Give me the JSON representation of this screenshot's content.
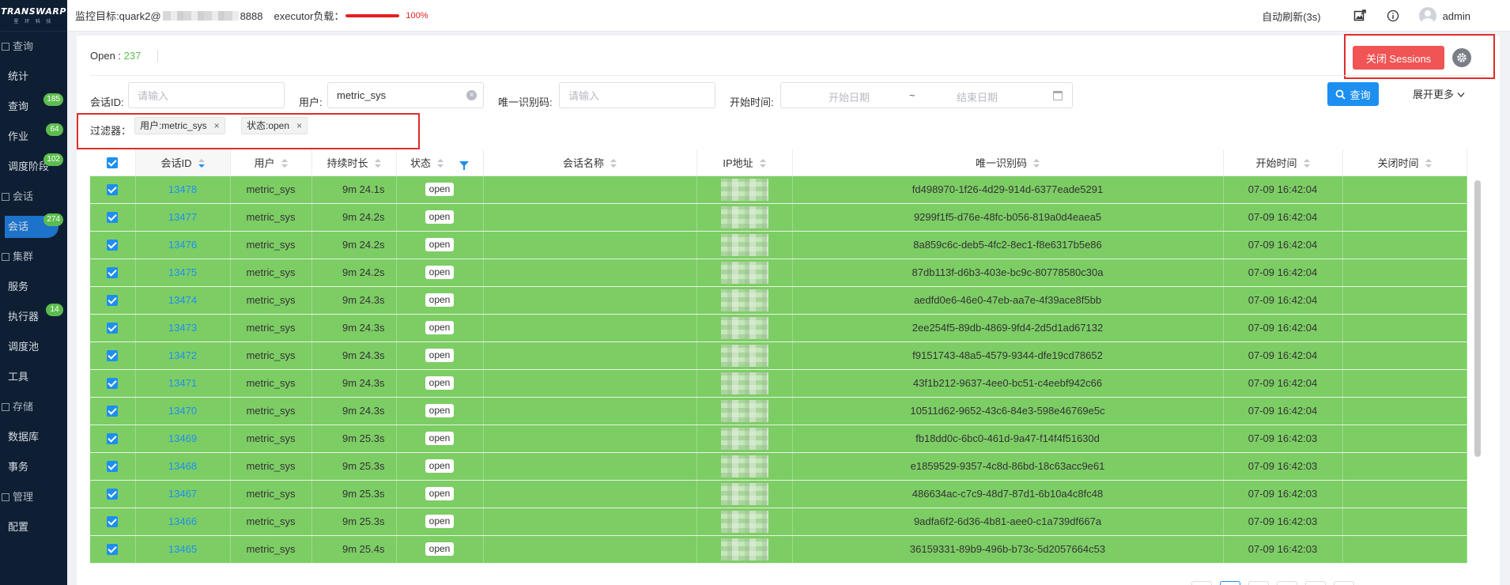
{
  "sidebar": {
    "logo": "TRANSWARP",
    "logo_sub": "星 环 科 技",
    "items": [
      {
        "label": "查询",
        "section": true
      },
      {
        "label": "统计"
      },
      {
        "label": "查询",
        "badge": "185"
      },
      {
        "label": "作业",
        "badge": "64"
      },
      {
        "label": "调度阶段",
        "badge": "102"
      },
      {
        "label": "会话",
        "section": true
      },
      {
        "label": "会话",
        "badge": "274",
        "active": true
      },
      {
        "label": "集群",
        "section": true
      },
      {
        "label": "服务"
      },
      {
        "label": "执行器",
        "badge": "14"
      },
      {
        "label": "调度池"
      },
      {
        "label": "工具"
      },
      {
        "label": "存储",
        "section": true
      },
      {
        "label": "数据库"
      },
      {
        "label": "事务"
      },
      {
        "label": "管理",
        "section": true
      },
      {
        "label": "配置"
      }
    ]
  },
  "header": {
    "monitor_label": "监控目标:quark2@",
    "monitor_port": "8888",
    "load_label": "executor负载：",
    "load_value": 1.0,
    "load_percent": "100%",
    "auto_refresh": "自动刷新(3s)",
    "user": "admin"
  },
  "summary": {
    "open_label": "Open : ",
    "open_count": "237",
    "close_button": "关闭 Sessions"
  },
  "search": {
    "session_id_label": "会话ID:",
    "session_id_placeholder": "请输入",
    "user_label": "用户:",
    "user_value": "metric_sys",
    "uid_label": "唯一识别码:",
    "uid_placeholder": "请输入",
    "start_time_label": "开始时间:",
    "start_date_placeholder": "开始日期",
    "date_separator": "~",
    "end_date_placeholder": "结束日期",
    "query_button": "查询",
    "expand_more": "展开更多"
  },
  "filter": {
    "label": "过滤器：",
    "tags": [
      "用户:metric_sys",
      "状态:open"
    ]
  },
  "table": {
    "columns": [
      "会话ID",
      "用户",
      "持续时长",
      "状态",
      "会话名称",
      "IP地址",
      "唯一识别码",
      "开始时间",
      "关闭时间"
    ],
    "rows": [
      {
        "id": "13478",
        "user": "metric_sys",
        "duration": "9m 24.1s",
        "status": "open",
        "name": "",
        "uid": "fd498970-1f26-4d29-914d-6377eade5291",
        "start": "07-09 16:42:04",
        "close": ""
      },
      {
        "id": "13477",
        "user": "metric_sys",
        "duration": "9m 24.2s",
        "status": "open",
        "name": "",
        "uid": "9299f1f5-d76e-48fc-b056-819a0d4eaea5",
        "start": "07-09 16:42:04",
        "close": ""
      },
      {
        "id": "13476",
        "user": "metric_sys",
        "duration": "9m 24.2s",
        "status": "open",
        "name": "",
        "uid": "8a859c6c-deb5-4fc2-8ec1-f8e6317b5e86",
        "start": "07-09 16:42:04",
        "close": ""
      },
      {
        "id": "13475",
        "user": "metric_sys",
        "duration": "9m 24.2s",
        "status": "open",
        "name": "",
        "uid": "87db113f-d6b3-403e-bc9c-80778580c30a",
        "start": "07-09 16:42:04",
        "close": ""
      },
      {
        "id": "13474",
        "user": "metric_sys",
        "duration": "9m 24.3s",
        "status": "open",
        "name": "",
        "uid": "aedfd0e6-46e0-47eb-aa7e-4f39ace8f5bb",
        "start": "07-09 16:42:04",
        "close": ""
      },
      {
        "id": "13473",
        "user": "metric_sys",
        "duration": "9m 24.3s",
        "status": "open",
        "name": "",
        "uid": "2ee254f5-89db-4869-9fd4-2d5d1ad67132",
        "start": "07-09 16:42:04",
        "close": ""
      },
      {
        "id": "13472",
        "user": "metric_sys",
        "duration": "9m 24.3s",
        "status": "open",
        "name": "",
        "uid": "f9151743-48a5-4579-9344-dfe19cd78652",
        "start": "07-09 16:42:04",
        "close": ""
      },
      {
        "id": "13471",
        "user": "metric_sys",
        "duration": "9m 24.3s",
        "status": "open",
        "name": "",
        "uid": "43f1b212-9637-4ee0-bc51-c4eebf942c66",
        "start": "07-09 16:42:04",
        "close": ""
      },
      {
        "id": "13470",
        "user": "metric_sys",
        "duration": "9m 24.3s",
        "status": "open",
        "name": "",
        "uid": "10511d62-9652-43c6-84e3-598e46769e5c",
        "start": "07-09 16:42:04",
        "close": ""
      },
      {
        "id": "13469",
        "user": "metric_sys",
        "duration": "9m 25.3s",
        "status": "open",
        "name": "",
        "uid": "fb18dd0c-6bc0-461d-9a47-f14f4f51630d",
        "start": "07-09 16:42:03",
        "close": ""
      },
      {
        "id": "13468",
        "user": "metric_sys",
        "duration": "9m 25.3s",
        "status": "open",
        "name": "",
        "uid": "e1859529-9357-4c8d-86bd-18c63acc9e61",
        "start": "07-09 16:42:03",
        "close": ""
      },
      {
        "id": "13467",
        "user": "metric_sys",
        "duration": "9m 25.3s",
        "status": "open",
        "name": "",
        "uid": "486634ac-c7c9-48d7-87d1-6b10a4c8fc48",
        "start": "07-09 16:42:03",
        "close": ""
      },
      {
        "id": "13466",
        "user": "metric_sys",
        "duration": "9m 25.3s",
        "status": "open",
        "name": "",
        "uid": "9adfa6f2-6d36-4b81-aee0-c1a739df667a",
        "start": "07-09 16:42:03",
        "close": ""
      },
      {
        "id": "13465",
        "user": "metric_sys",
        "duration": "9m 25.4s",
        "status": "open",
        "name": "",
        "uid": "36159331-89b9-496b-b73c-5d2057664c53",
        "start": "07-09 16:42:03",
        "close": ""
      }
    ]
  },
  "colors": {
    "row_highlight": "#7dcd65",
    "accent": "#1d8ff0",
    "danger": "#f05454",
    "sidebar_bg": "#0f1f33"
  }
}
